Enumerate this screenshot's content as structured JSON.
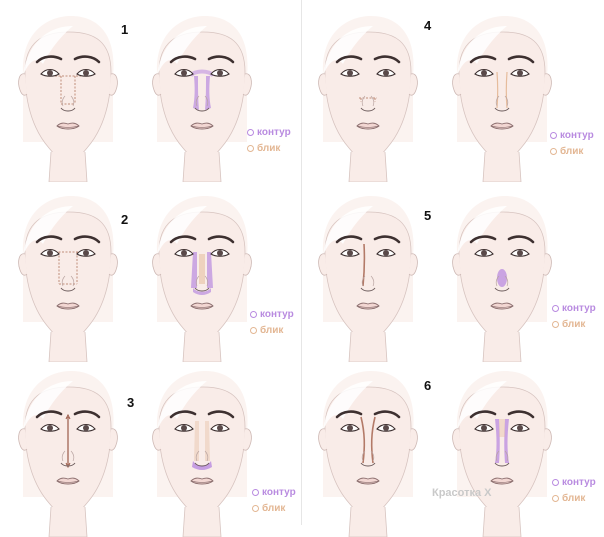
{
  "panels": [
    {
      "number": "1",
      "legend": {
        "contour": "контур",
        "highlight": "блик"
      }
    },
    {
      "number": "2",
      "legend": {
        "contour": "контур",
        "highlight": "блик"
      }
    },
    {
      "number": "3",
      "legend": {
        "contour": "контур",
        "highlight": "блик"
      }
    },
    {
      "number": "4",
      "legend": {
        "contour": "контур",
        "highlight": "блик"
      }
    },
    {
      "number": "5",
      "legend": {
        "contour": "контур",
        "highlight": "блик"
      }
    },
    {
      "number": "6",
      "legend": {
        "contour": "контур",
        "highlight": "блик"
      }
    }
  ],
  "watermark": "Красотка Х",
  "colors": {
    "contour": "#b98be0",
    "highlight": "#e3b794",
    "skin": "#f9ece8",
    "hair": "#fbf3f0",
    "line": "#6b5b5b"
  }
}
